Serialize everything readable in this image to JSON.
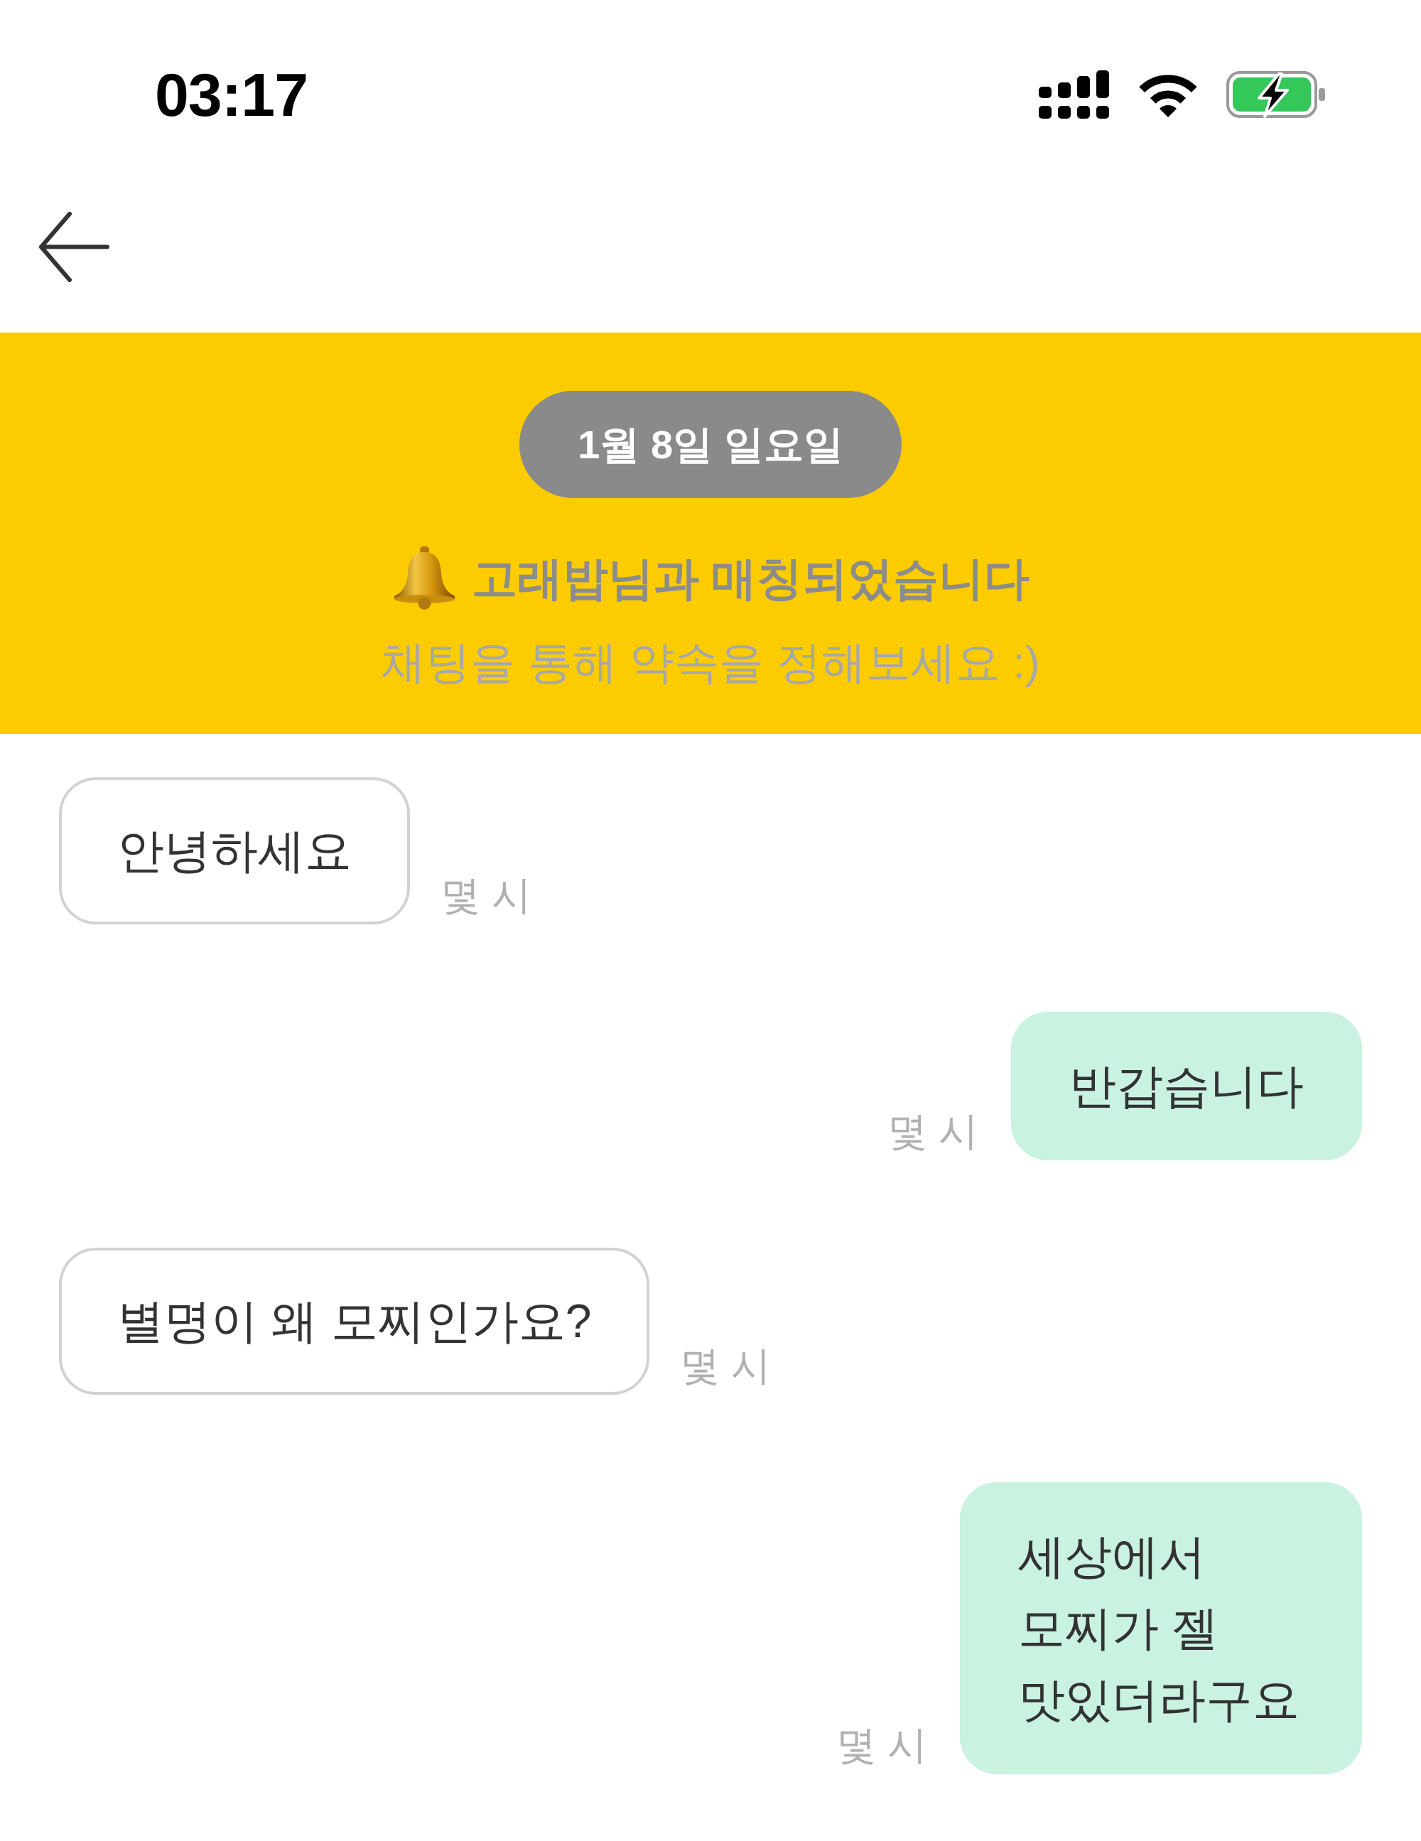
{
  "status_bar": {
    "time": "03:17"
  },
  "banner": {
    "date": "1월 8일 일요일",
    "title": "고래밥님과 매칭되었습니다",
    "subtitle": "채팅을 통해 약속을 정해보세요 :)"
  },
  "messages": [
    {
      "kind": "received",
      "text": "안녕하세요",
      "time": "몇 시"
    },
    {
      "kind": "sent",
      "text": "반갑습니다",
      "time": "몇 시"
    },
    {
      "kind": "received",
      "text": "별명이 왜 모찌인가요?",
      "time": "몇 시"
    },
    {
      "kind": "sent",
      "text": "세상에서 모찌가 젤 맛있더라구요",
      "time": "몇 시"
    }
  ]
}
